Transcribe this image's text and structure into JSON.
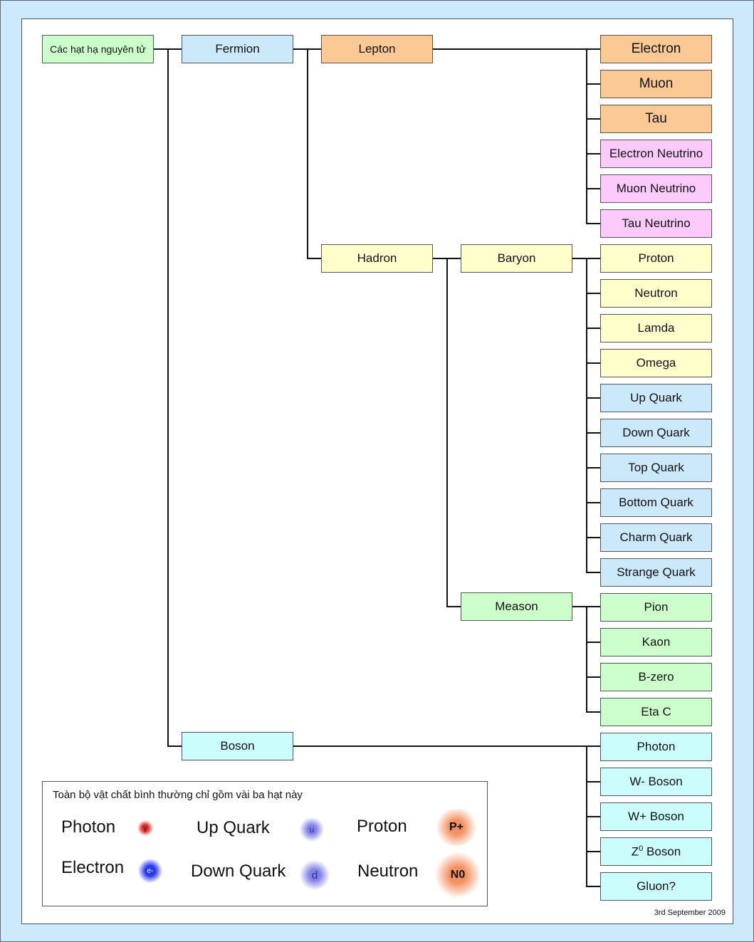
{
  "root": {
    "label": "Các hạt hạ nguyên tử",
    "color": "#ccffcc"
  },
  "level1": {
    "fermion": "Fermion",
    "boson": "Boson"
  },
  "level2": {
    "lepton": "Lepton",
    "hadron": "Hadron"
  },
  "level3": {
    "baryon": "Baryon",
    "meason": "Meason"
  },
  "leptons": [
    "Electron",
    "Muon",
    "Tau",
    "Electron Neutrino",
    "Muon Neutrino",
    "Tau Neutrino"
  ],
  "baryons": [
    "Proton",
    "Neutron",
    "Lamda",
    "Omega"
  ],
  "quarks": [
    "Up Quark",
    "Down Quark",
    "Top Quark",
    "Bottom Quark",
    "Charm Quark",
    "Strange Quark"
  ],
  "measons": [
    "Pion",
    "Kaon",
    "B-zero",
    "Eta C"
  ],
  "bosons": [
    "Photon",
    "W- Boson",
    "W+ Boson",
    "Z",
    "Gluon?"
  ],
  "z_boson": {
    "base": "Z",
    "sup": "0",
    "rest": " Boson"
  },
  "legend": {
    "title": "Toàn bộ vật chất bình thường chỉ gồm vài ba hạt này",
    "items": [
      {
        "label": "Photon",
        "symbol": "γ",
        "color": "#e83030"
      },
      {
        "label": "Electron",
        "symbol": "e-",
        "color": "#2a3af0"
      },
      {
        "label": "Up Quark",
        "symbol": "u",
        "color": "#8080e8"
      },
      {
        "label": "Down Quark",
        "symbol": "d",
        "color": "#8080e8"
      },
      {
        "label": "Proton",
        "symbol": "P+",
        "color": "#f59060"
      },
      {
        "label": "Neutron",
        "symbol": "N0",
        "color": "#f59060"
      }
    ]
  },
  "date": "3rd September 2009"
}
